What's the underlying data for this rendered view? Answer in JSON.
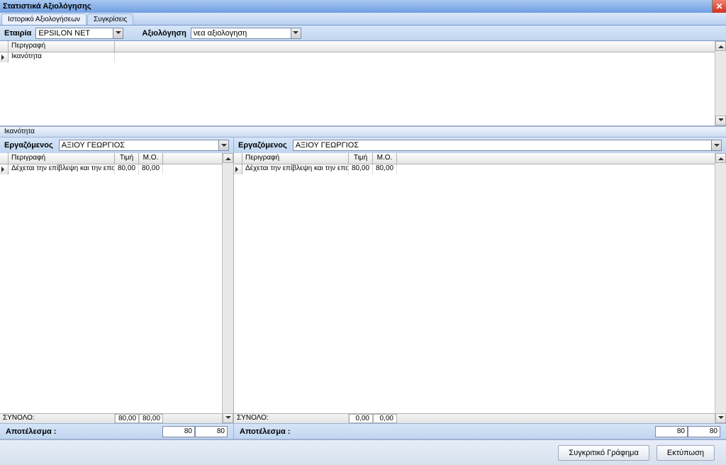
{
  "window": {
    "title": "Στατιστικά Αξιολόγησης"
  },
  "tabs": {
    "history": "Ιστορικό Αξιολογήσεων",
    "compare": "Συγκρίσεις"
  },
  "filters": {
    "company_label": "Εταιρία",
    "company_value": "EPSILON NET",
    "evaluation_label": "Αξιολόγηση",
    "evaluation_value": "νεα αξιολογηση"
  },
  "topGrid": {
    "header": "Περιγραφή",
    "row1": "Ικανότητα"
  },
  "sectionLabel": "Ικανότητα",
  "employee_label": "Εργαζόμενος",
  "left": {
    "employee_value": "ΑΞΙΟΥ ΓΕΩΡΓΙΟΣ",
    "h_desc": "Περιγραφή",
    "h_val": "Τιμή",
    "h_avg": "Μ.Ο.",
    "row_desc": "Δέχεται την επίβλεψη και την εποικ",
    "row_val": "80,00",
    "row_avg": "80,00",
    "total_label": "ΣΥΝΟΛΟ:",
    "total_val": "80,00",
    "total_avg": "80,00",
    "result_label": "Αποτέλεσμα :",
    "result_val1": "80",
    "result_val2": "80"
  },
  "right": {
    "employee_value": "ΑΞΙΟΥ ΓΕΩΡΓΙΟΣ",
    "h_desc": "Περιγραφή",
    "h_val": "Τιμή",
    "h_avg": "Μ.Ο.",
    "row_desc": "Δέχεται την επίβλεψη και την εποικ",
    "row_val": "80,00",
    "row_avg": "80,00",
    "total_label": "ΣΥΝΟΛΟ:",
    "total_val": "0,00",
    "total_avg": "0,00",
    "result_label": "Αποτέλεσμα :",
    "result_val1": "80",
    "result_val2": "80"
  },
  "buttons": {
    "chart": "Συγκριτικό Γράφημα",
    "print": "Εκτύπωση"
  }
}
